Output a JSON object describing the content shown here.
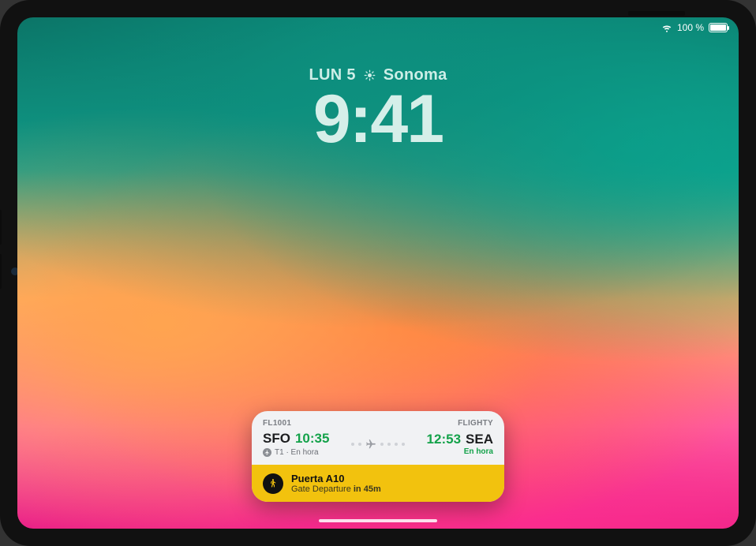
{
  "status": {
    "battery_pct": "100 %"
  },
  "lockscreen": {
    "date": "LUN 5",
    "location": "Sonoma",
    "time": "9:41"
  },
  "live_activity": {
    "flight_no": "FL1001",
    "app_name": "FLIGHTY",
    "origin": {
      "code": "SFO",
      "time": "10:35",
      "sub": "T1 · En hora"
    },
    "dest": {
      "code": "SEA",
      "time": "12:53",
      "sub": "En hora"
    },
    "gate": {
      "title": "Puerta A10",
      "subtitle_prefix": "Gate Departure ",
      "subtitle_em": "in 45m"
    }
  }
}
